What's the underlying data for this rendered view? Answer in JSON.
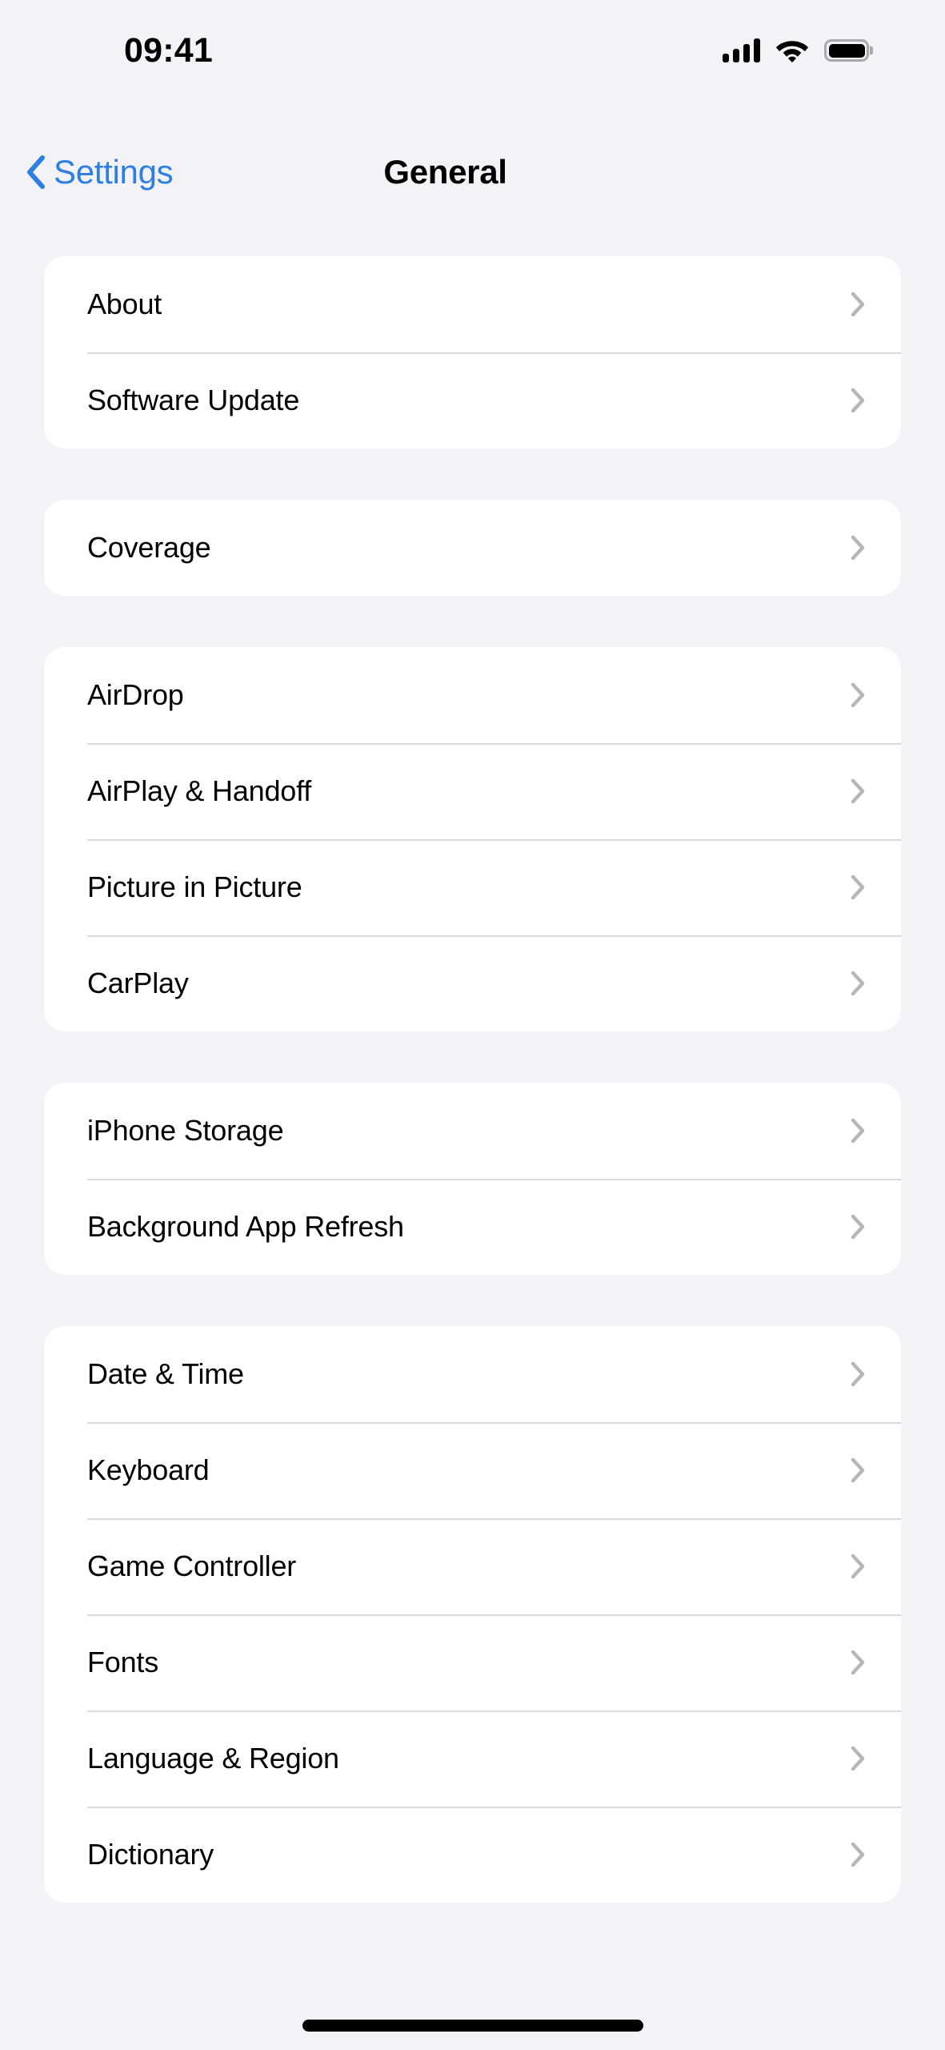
{
  "status_bar": {
    "time": "09:41",
    "cellular_icon": "cellular-signal-icon",
    "wifi_icon": "wifi-icon",
    "battery_icon": "battery-full-icon",
    "signal_bars": 4,
    "battery_level": 100
  },
  "nav": {
    "back_label": "Settings",
    "back_icon": "chevron-left-icon",
    "title": "General"
  },
  "colors": {
    "background": "#f2f2f7",
    "card": "#ffffff",
    "accent_blue": "#2f7fe0",
    "separator": "#d9d9de",
    "chevron_gray": "#b6b6bb",
    "label": "#000000"
  },
  "groups": [
    {
      "rows": [
        {
          "label": "About",
          "chevron": "chevron-right-icon"
        },
        {
          "label": "Software Update",
          "chevron": "chevron-right-icon"
        }
      ]
    },
    {
      "rows": [
        {
          "label": "Coverage",
          "chevron": "chevron-right-icon"
        }
      ]
    },
    {
      "rows": [
        {
          "label": "AirDrop",
          "chevron": "chevron-right-icon"
        },
        {
          "label": "AirPlay & Handoff",
          "chevron": "chevron-right-icon"
        },
        {
          "label": "Picture in Picture",
          "chevron": "chevron-right-icon"
        },
        {
          "label": "CarPlay",
          "chevron": "chevron-right-icon"
        }
      ]
    },
    {
      "rows": [
        {
          "label": "iPhone Storage",
          "chevron": "chevron-right-icon"
        },
        {
          "label": "Background App Refresh",
          "chevron": "chevron-right-icon"
        }
      ]
    },
    {
      "rows": [
        {
          "label": "Date & Time",
          "chevron": "chevron-right-icon"
        },
        {
          "label": "Keyboard",
          "chevron": "chevron-right-icon"
        },
        {
          "label": "Game Controller",
          "chevron": "chevron-right-icon"
        },
        {
          "label": "Fonts",
          "chevron": "chevron-right-icon"
        },
        {
          "label": "Language & Region",
          "chevron": "chevron-right-icon"
        },
        {
          "label": "Dictionary",
          "chevron": "chevron-right-icon"
        }
      ]
    }
  ],
  "home_indicator": "home-indicator"
}
